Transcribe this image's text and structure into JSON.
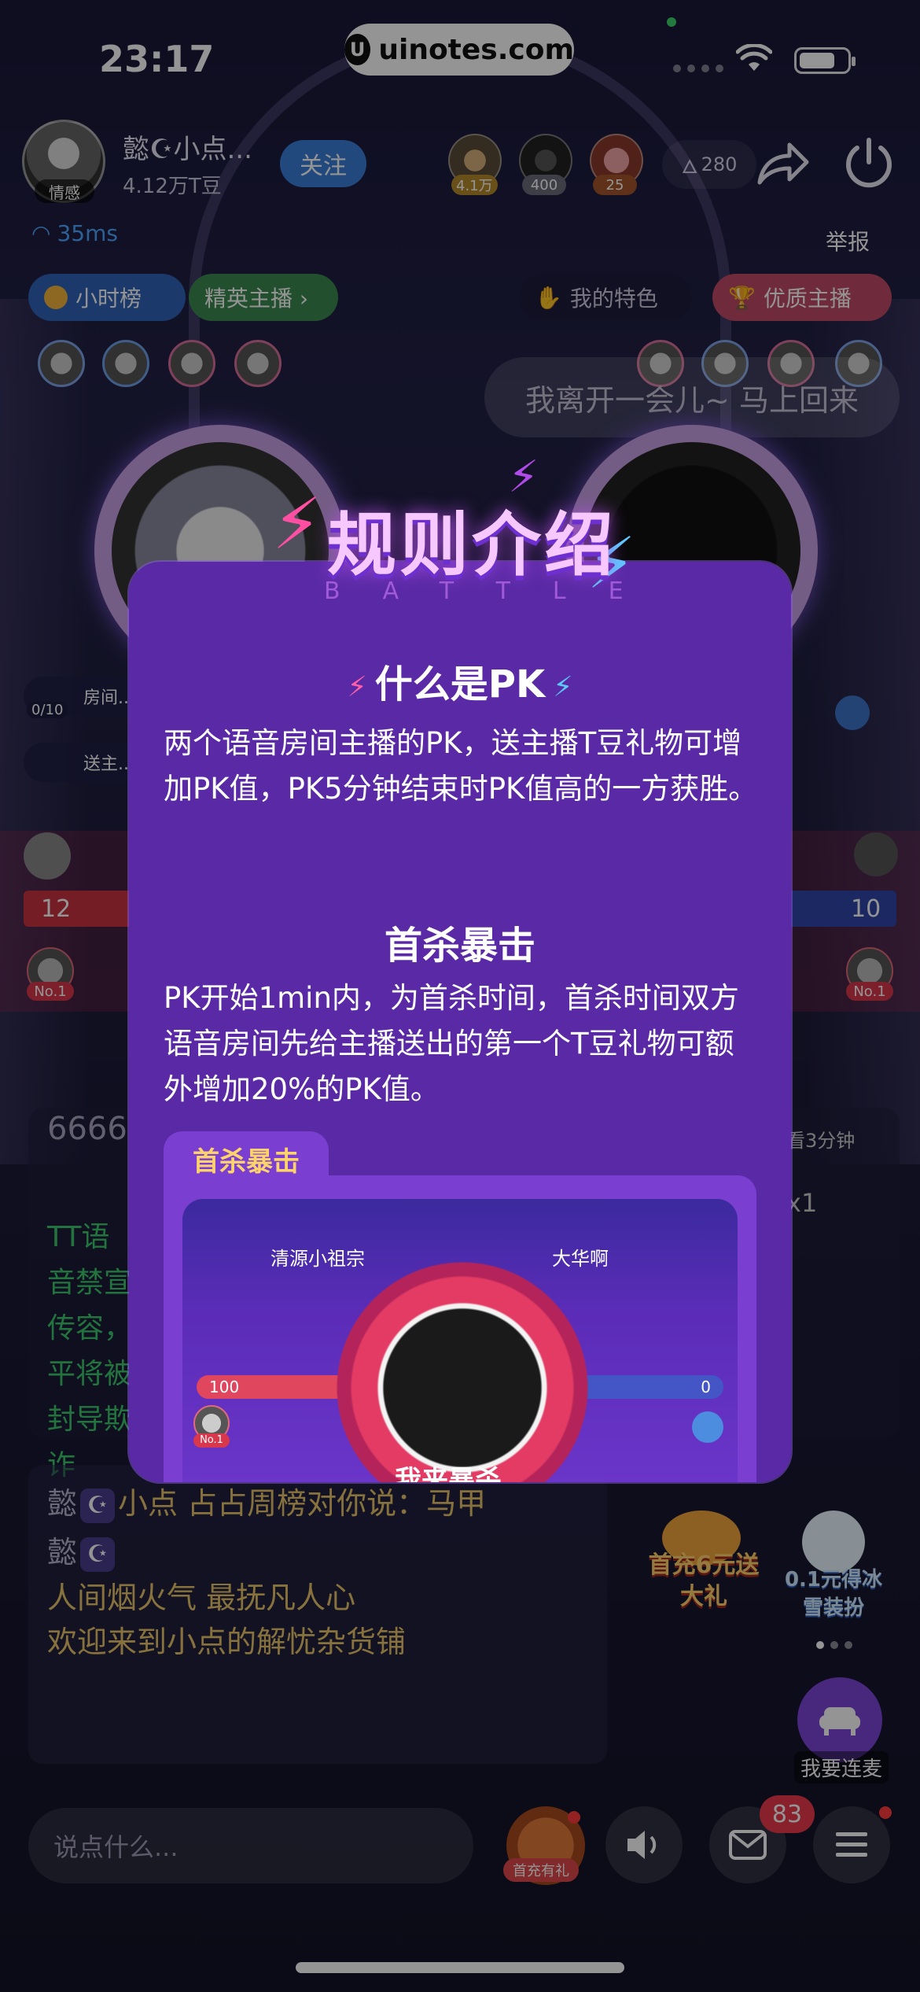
{
  "status_bar": {
    "time": "23:17",
    "watermark": "uinotes.com",
    "watermark_logo": "U"
  },
  "room": {
    "host_name": "懿☪小点...",
    "host_beans": "4.12万T豆",
    "host_tag": "情感",
    "follow_label": "关注",
    "viewers": [
      {
        "badge": "4.1万",
        "badge_color": "#b38a2a"
      },
      {
        "badge": "400",
        "badge_color": "#6b6b7a"
      },
      {
        "badge": "25",
        "badge_color": "#a3552a"
      }
    ],
    "heat": "280",
    "ping": "35ms",
    "report_label": "举报",
    "pills": {
      "hour_rank": "小时榜",
      "elite_host": "精英主播 ›",
      "my_feature": "我的特色",
      "quality_host": "优质主播"
    },
    "away_message": "我离开一会儿~ 马上回来",
    "left_chips": [
      "房间...",
      "送主..."
    ],
    "left_chip_counter": "0/10",
    "pk": {
      "left_score": "12",
      "right_score": "10",
      "no1_label": "No.1"
    },
    "peek": {
      "number": "6666",
      "green_text": "TT语音禁宣传容，平将被封导欺诈",
      "right_text": "看3分钟",
      "right_count": "x1"
    }
  },
  "chat": {
    "lines": [
      {
        "who": "懿",
        "moon": "☪",
        "text": "小点    占占周榜对你说：马甲"
      },
      {
        "who": "懿",
        "moon": "☪",
        "text": ""
      },
      {
        "who": "",
        "moon": "",
        "text": "人间烟火气 最抚凡人心"
      },
      {
        "who": "",
        "moon": "",
        "text": "欢迎来到小点的解忧杂货铺"
      }
    ]
  },
  "promos": {
    "first_charge": "首充6元送大礼",
    "ice_outfit": "0.1元得冰雪装扮"
  },
  "mic": {
    "label": "我要连麦"
  },
  "bottom_bar": {
    "input_placeholder": "说点什么...",
    "gift_tag": "首充有礼",
    "message_badge": "83"
  },
  "modal": {
    "title": "规则介绍",
    "subtitle": "BATTLE",
    "section1_title": "什么是PK",
    "section1_body": "两个语音房间主播的PK，送主播T豆礼物可增加PK值，PK5分钟结束时PK值高的一方获胜。",
    "section2_title": "首杀暴击",
    "section2_body": "PK开始1min内，为首杀时间，首杀时间双方语音房间先给主播送出的第一个T豆礼物可额外增加20%的PK值。",
    "preview_tab": "首杀暴击",
    "preview": {
      "left_name": "清源小祖宗",
      "right_name": "大华啊",
      "left_score": "100",
      "right_score": "0",
      "no1_label": "No.1",
      "banner_text": "我来暴杀"
    }
  },
  "colors": {
    "modal_bg": "#5a2aa6",
    "accent_pink": "#ff5fa6",
    "accent_blue": "#5fc8ff",
    "chat_gold": "#e8c46a"
  }
}
